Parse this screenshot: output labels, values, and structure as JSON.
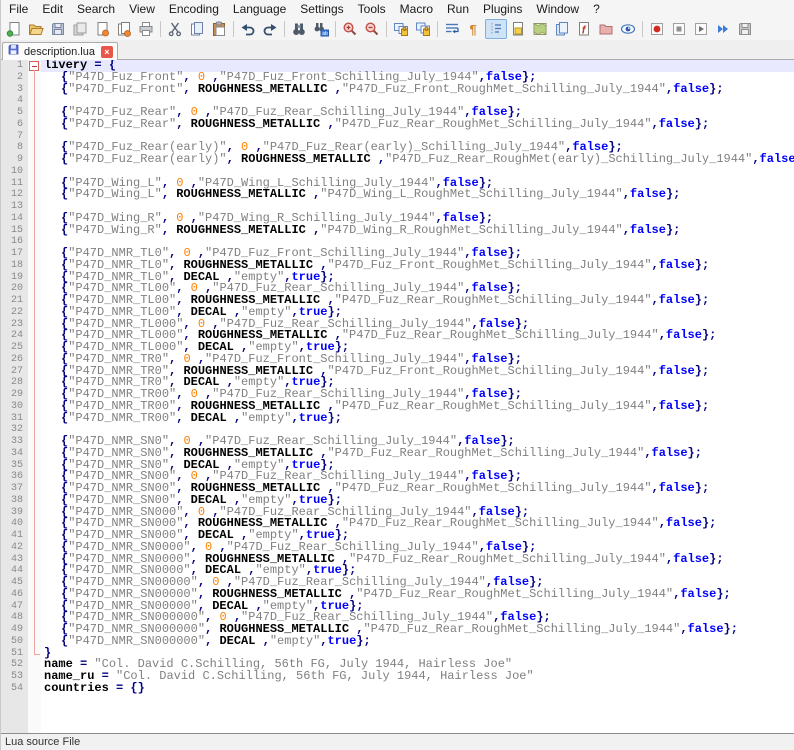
{
  "menu": {
    "items": [
      "File",
      "Edit",
      "Search",
      "View",
      "Encoding",
      "Language",
      "Settings",
      "Tools",
      "Macro",
      "Run",
      "Plugins",
      "Window",
      "?"
    ]
  },
  "toolbar": {
    "icons": [
      {
        "name": "new-file"
      },
      {
        "name": "open-file"
      },
      {
        "name": "save-file"
      },
      {
        "name": "save-all"
      },
      {
        "name": "close-file"
      },
      {
        "name": "close-all"
      },
      {
        "name": "print"
      },
      {
        "name": "cut",
        "sep_before": true
      },
      {
        "name": "copy"
      },
      {
        "name": "paste"
      },
      {
        "name": "undo",
        "sep_before": true
      },
      {
        "name": "redo"
      },
      {
        "name": "find",
        "sep_before": true
      },
      {
        "name": "replace"
      },
      {
        "name": "zoom-in",
        "sep_before": true
      },
      {
        "name": "zoom-out"
      },
      {
        "name": "sync-vertical-scrolling",
        "sep_before": true
      },
      {
        "name": "sync-horizontal-scrolling"
      },
      {
        "name": "word-wrap",
        "sep_before": true
      },
      {
        "name": "show-all-characters"
      },
      {
        "name": "show-indent-guide",
        "active": true
      },
      {
        "name": "user-defined-language"
      },
      {
        "name": "document-map"
      },
      {
        "name": "doc-switcher"
      },
      {
        "name": "function-list"
      },
      {
        "name": "folder-as-workspace"
      },
      {
        "name": "monitoring"
      },
      {
        "name": "macro-record",
        "sep_before": true
      },
      {
        "name": "macro-stop"
      },
      {
        "name": "macro-playback"
      },
      {
        "name": "macro-run-multiple"
      },
      {
        "name": "macro-save"
      }
    ]
  },
  "tabs": [
    {
      "label": "description.lua",
      "active": true,
      "saved": true
    }
  ],
  "status_bar": {
    "text": "Lua source File"
  },
  "colors": {
    "current_line_bg": "#E8E8FF",
    "fold_box": "#D95F53",
    "fold_line": "#EDA49C",
    "string": "#808080",
    "number": "#FF8000",
    "keyword": "#0000FF",
    "operator": "#000080",
    "active_icon_bg": "#CFE3F7",
    "tab_close": "#E8564A"
  },
  "editor": {
    "current_line": 1,
    "patterns": {
      "A": [
        [
          "op",
          "{"
        ],
        [
          "str",
          "\"$P\""
        ],
        [
          "op",
          ", "
        ],
        [
          "num",
          "0"
        ],
        [
          "op",
          " ,"
        ],
        [
          "str",
          "\"$X\""
        ],
        [
          "op",
          ","
        ],
        [
          "kw",
          "false"
        ],
        [
          "op",
          "};"
        ]
      ],
      "B": [
        [
          "op",
          "{"
        ],
        [
          "str",
          "\"$P\""
        ],
        [
          "op",
          ", "
        ],
        [
          "const",
          "ROUGHNESS_METALLIC"
        ],
        [
          "op",
          " ,"
        ],
        [
          "str",
          "\"$X\""
        ],
        [
          "op",
          ","
        ],
        [
          "kw",
          "false"
        ],
        [
          "op",
          "};"
        ]
      ],
      "C": [
        [
          "op",
          "{"
        ],
        [
          "str",
          "\"$P\""
        ],
        [
          "op",
          ", "
        ],
        [
          "const",
          "DECAL"
        ],
        [
          "op",
          " ,"
        ],
        [
          "str",
          "\"empty\""
        ],
        [
          "op",
          ","
        ],
        [
          "kw",
          "true"
        ],
        [
          "op",
          "};"
        ]
      ]
    },
    "lines": [
      {
        "f": "s",
        "seg": [
          [
            "id",
            "livery"
          ],
          [
            "op",
            " = {"
          ]
        ]
      },
      {
        "f": "m",
        "i": 1,
        "pat": "A",
        "P": "P47D_Fuz_Front",
        "X": "P47D_Fuz_Front_Schilling_July_1944"
      },
      {
        "f": "m",
        "i": 1,
        "pat": "B",
        "P": "P47D_Fuz_Front",
        "X": "P47D_Fuz_Front_RoughMet_Schilling_July_1944"
      },
      {
        "f": "m"
      },
      {
        "f": "m",
        "i": 1,
        "pat": "A",
        "P": "P47D_Fuz_Rear",
        "X": "P47D_Fuz_Rear_Schilling_July_1944"
      },
      {
        "f": "m",
        "i": 1,
        "pat": "B",
        "P": "P47D_Fuz_Rear",
        "X": "P47D_Fuz_Rear_RoughMet_Schilling_July_1944"
      },
      {
        "f": "m"
      },
      {
        "f": "m",
        "i": 1,
        "pat": "A",
        "P": "P47D_Fuz_Rear(early)",
        "X": "P47D_Fuz_Rear(early)_Schilling_July_1944"
      },
      {
        "f": "m",
        "i": 1,
        "pat": "B",
        "P": "P47D_Fuz_Rear(early)",
        "X": "P47D_Fuz_Rear_RoughMet(early)_Schilling_July_1944"
      },
      {
        "f": "m"
      },
      {
        "f": "m",
        "i": 1,
        "pat": "A",
        "P": "P47D_Wing_L",
        "X": "P47D_Wing_L_Schilling_July_1944"
      },
      {
        "f": "m",
        "i": 1,
        "pat": "B",
        "P": "P47D_Wing_L",
        "X": "P47D_Wing_L_RoughMet_Schilling_July_1944"
      },
      {
        "f": "m"
      },
      {
        "f": "m",
        "i": 1,
        "pat": "A",
        "P": "P47D_Wing_R",
        "X": "P47D_Wing_R_Schilling_July_1944"
      },
      {
        "f": "m",
        "i": 1,
        "pat": "B",
        "P": "P47D_Wing_R",
        "X": "P47D_Wing_R_RoughMet_Schilling_July_1944"
      },
      {
        "f": "m"
      },
      {
        "f": "m",
        "i": 1,
        "pat": "A",
        "P": "P47D_NMR_TL0",
        "X": "P47D_Fuz_Front_Schilling_July_1944"
      },
      {
        "f": "m",
        "i": 1,
        "pat": "B",
        "P": "P47D_NMR_TL0",
        "X": "P47D_Fuz_Front_RoughMet_Schilling_July_1944"
      },
      {
        "f": "m",
        "i": 1,
        "pat": "C",
        "P": "P47D_NMR_TL0"
      },
      {
        "f": "m",
        "i": 1,
        "pat": "A",
        "P": "P47D_NMR_TL00",
        "X": "P47D_Fuz_Rear_Schilling_July_1944"
      },
      {
        "f": "m",
        "i": 1,
        "pat": "B",
        "P": "P47D_NMR_TL00",
        "X": "P47D_Fuz_Rear_RoughMet_Schilling_July_1944"
      },
      {
        "f": "m",
        "i": 1,
        "pat": "C",
        "P": "P47D_NMR_TL00"
      },
      {
        "f": "m",
        "i": 1,
        "pat": "A",
        "P": "P47D_NMR_TL000",
        "X": "P47D_Fuz_Rear_Schilling_July_1944"
      },
      {
        "f": "m",
        "i": 1,
        "pat": "B",
        "P": "P47D_NMR_TL000",
        "X": "P47D_Fuz_Rear_RoughMet_Schilling_July_1944"
      },
      {
        "f": "m",
        "i": 1,
        "pat": "C",
        "P": "P47D_NMR_TL000"
      },
      {
        "f": "m",
        "i": 1,
        "pat": "A",
        "P": "P47D_NMR_TR0",
        "X": "P47D_Fuz_Front_Schilling_July_1944"
      },
      {
        "f": "m",
        "i": 1,
        "pat": "B",
        "P": "P47D_NMR_TR0",
        "X": "P47D_Fuz_Front_RoughMet_Schilling_July_1944"
      },
      {
        "f": "m",
        "i": 1,
        "pat": "C",
        "P": "P47D_NMR_TR0"
      },
      {
        "f": "m",
        "i": 1,
        "pat": "A",
        "P": "P47D_NMR_TR00",
        "X": "P47D_Fuz_Rear_Schilling_July_1944"
      },
      {
        "f": "m",
        "i": 1,
        "pat": "B",
        "P": "P47D_NMR_TR00",
        "X": "P47D_Fuz_Rear_RoughMet_Schilling_July_1944"
      },
      {
        "f": "m",
        "i": 1,
        "pat": "C",
        "P": "P47D_NMR_TR00"
      },
      {
        "f": "m"
      },
      {
        "f": "m",
        "i": 1,
        "pat": "A",
        "P": "P47D_NMR_SN0",
        "X": "P47D_Fuz_Rear_Schilling_July_1944"
      },
      {
        "f": "m",
        "i": 1,
        "pat": "B",
        "P": "P47D_NMR_SN0",
        "X": "P47D_Fuz_Rear_RoughMet_Schilling_July_1944"
      },
      {
        "f": "m",
        "i": 1,
        "pat": "C",
        "P": "P47D_NMR_SN0"
      },
      {
        "f": "m",
        "i": 1,
        "pat": "A",
        "P": "P47D_NMR_SN00",
        "X": "P47D_Fuz_Rear_Schilling_July_1944"
      },
      {
        "f": "m",
        "i": 1,
        "pat": "B",
        "P": "P47D_NMR_SN00",
        "X": "P47D_Fuz_Rear_RoughMet_Schilling_July_1944"
      },
      {
        "f": "m",
        "i": 1,
        "pat": "C",
        "P": "P47D_NMR_SN00"
      },
      {
        "f": "m",
        "i": 1,
        "pat": "A",
        "P": "P47D_NMR_SN000",
        "X": "P47D_Fuz_Rear_Schilling_July_1944"
      },
      {
        "f": "m",
        "i": 1,
        "pat": "B",
        "P": "P47D_NMR_SN000",
        "X": "P47D_Fuz_Rear_RoughMet_Schilling_July_1944"
      },
      {
        "f": "m",
        "i": 1,
        "pat": "C",
        "P": "P47D_NMR_SN000"
      },
      {
        "f": "m",
        "i": 1,
        "pat": "A",
        "P": "P47D_NMR_SN0000",
        "X": "P47D_Fuz_Rear_Schilling_July_1944"
      },
      {
        "f": "m",
        "i": 1,
        "pat": "B",
        "P": "P47D_NMR_SN0000",
        "X": "P47D_Fuz_Rear_RoughMet_Schilling_July_1944"
      },
      {
        "f": "m",
        "i": 1,
        "pat": "C",
        "P": "P47D_NMR_SN0000"
      },
      {
        "f": "m",
        "i": 1,
        "pat": "A",
        "P": "P47D_NMR_SN00000",
        "X": "P47D_Fuz_Rear_Schilling_July_1944"
      },
      {
        "f": "m",
        "i": 1,
        "pat": "B",
        "P": "P47D_NMR_SN00000",
        "X": "P47D_Fuz_Rear_RoughMet_Schilling_July_1944"
      },
      {
        "f": "m",
        "i": 1,
        "pat": "C",
        "P": "P47D_NMR_SN00000"
      },
      {
        "f": "m",
        "i": 1,
        "pat": "A",
        "P": "P47D_NMR_SN000000",
        "X": "P47D_Fuz_Rear_Schilling_July_1944"
      },
      {
        "f": "m",
        "i": 1,
        "pat": "B",
        "P": "P47D_NMR_SN000000",
        "X": "P47D_Fuz_Rear_RoughMet_Schilling_July_1944"
      },
      {
        "f": "m",
        "i": 1,
        "pat": "C",
        "P": "P47D_NMR_SN000000"
      },
      {
        "f": "e",
        "seg": [
          [
            "op",
            "}"
          ]
        ]
      },
      {
        "seg": [
          [
            "id",
            "name"
          ],
          [
            "op",
            " = "
          ],
          [
            "str",
            "\"Col. David C.Schilling, 56th FG, July 1944, Hairless Joe\""
          ]
        ]
      },
      {
        "seg": [
          [
            "id",
            "name_ru"
          ],
          [
            "op",
            " = "
          ],
          [
            "str",
            "\"Col. David C.Schilling, 56th FG, July 1944, Hairless Joe\""
          ]
        ]
      },
      {
        "seg": [
          [
            "id",
            "countries"
          ],
          [
            "op",
            " = "
          ],
          [
            "op",
            "{}"
          ]
        ]
      }
    ]
  }
}
